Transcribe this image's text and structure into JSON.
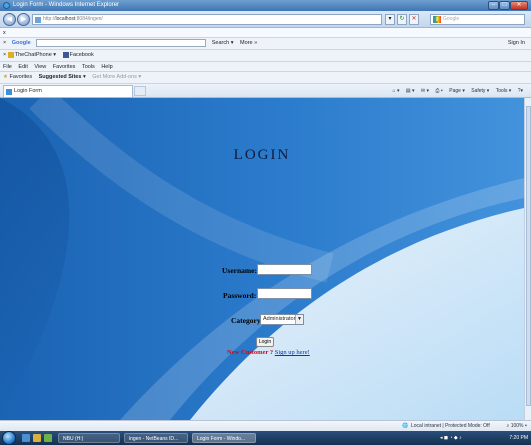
{
  "window": {
    "title": "Login Form - Windows Internet Explorer"
  },
  "address_bar": {
    "url_prefix": "http://",
    "url_host": "localhost",
    "url_rest": ":8084/ingen/",
    "search_placeholder": "Google"
  },
  "toolbar_row1": {
    "close_glyph": "x"
  },
  "google_toolbar": {
    "logo": "Google",
    "search_button": "Search",
    "more": "More »",
    "sign_in": "Sign In"
  },
  "chatphone_toolbar": {
    "item1": "TheChatPhone",
    "item2": "Facebook"
  },
  "menu": {
    "items": [
      "File",
      "Edit",
      "View",
      "Favorites",
      "Tools",
      "Help"
    ]
  },
  "favorites_bar": {
    "favorites": "Favorites",
    "suggested": "Suggested Sites",
    "addons": "Get More Add-ons"
  },
  "tab": {
    "title": "Login Form"
  },
  "command_bar": {
    "items": [
      "Page",
      "Safety",
      "Tools"
    ]
  },
  "login": {
    "title": "LOGIN",
    "username_label": "Username:",
    "password_label": "Password:",
    "category_label": "Category:",
    "category_selected": "Administrator",
    "login_button": "Login",
    "new_customer": "New Customer ?",
    "signup_link": "Sign up here!"
  },
  "statusbar": {
    "zone": "Local intranet | Protected Mode: Off",
    "zoom": "100%"
  },
  "taskbar": {
    "items": [
      "NBU (H:)",
      "ingen - NetBeans ID...",
      "Login Form - Windo..."
    ],
    "clock": "7:20 PM"
  },
  "colors": {
    "page_bg": "#2c7ccd",
    "title": "#0d1c3f",
    "new_customer": "#c0101a",
    "link": "#0a3aa8"
  }
}
